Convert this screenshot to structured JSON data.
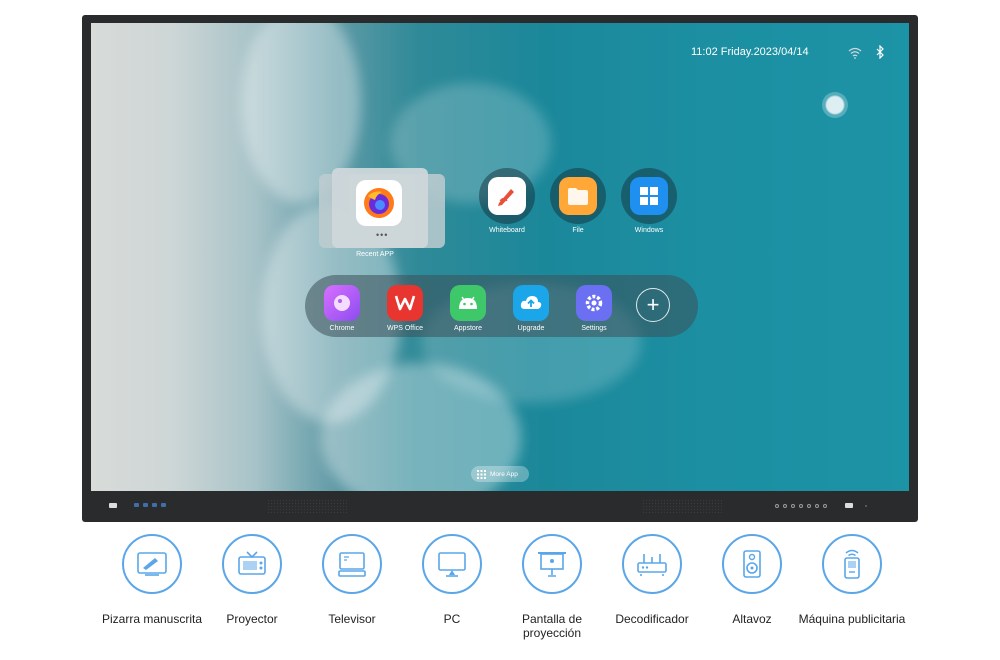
{
  "status_bar": {
    "datetime": "11:02 Friday.2023/04/14",
    "wifi_icon": "wifi-icon",
    "bluetooth_icon": "bluetooth-icon"
  },
  "recent": {
    "label": "Recent APP",
    "app_icon": "firefox-icon"
  },
  "top_apps": [
    {
      "label": "Whiteboard",
      "icon": "whiteboard-icon"
    },
    {
      "label": "File",
      "icon": "folder-icon"
    },
    {
      "label": "Windows",
      "icon": "windows-icon"
    }
  ],
  "dock": {
    "apps": [
      {
        "label": "Chrome",
        "icon": "browser-icon",
        "color": "#b65cf0"
      },
      {
        "label": "WPS Office",
        "icon": "wps-icon",
        "color": "#e9352f"
      },
      {
        "label": "Appstore",
        "icon": "android-icon",
        "color": "#3ec86a"
      },
      {
        "label": "Upgrade",
        "icon": "upload-cloud-icon",
        "color": "#1aa6e8"
      },
      {
        "label": "Settings",
        "icon": "gear-icon",
        "color": "#6b6ff2"
      }
    ],
    "add_label": "+"
  },
  "more_app": {
    "label": "More App"
  },
  "features": [
    {
      "label": "Pizarra manuscrita",
      "icon": "drawing-board-icon"
    },
    {
      "label": "Proyector",
      "icon": "retro-tv-icon"
    },
    {
      "label": "Televisor",
      "icon": "television-icon"
    },
    {
      "label": "PC",
      "icon": "monitor-icon"
    },
    {
      "label": "Pantalla de proyección",
      "icon": "projection-screen-icon"
    },
    {
      "label": "Decodificador",
      "icon": "set-top-box-icon"
    },
    {
      "label": "Altavoz",
      "icon": "speaker-icon"
    },
    {
      "label": "Máquina publicitaria",
      "icon": "ad-kiosk-icon"
    }
  ],
  "colors": {
    "feature_accent": "#5aa6e8",
    "ocean": "#1b889a",
    "bezel": "#2a2b2d"
  }
}
